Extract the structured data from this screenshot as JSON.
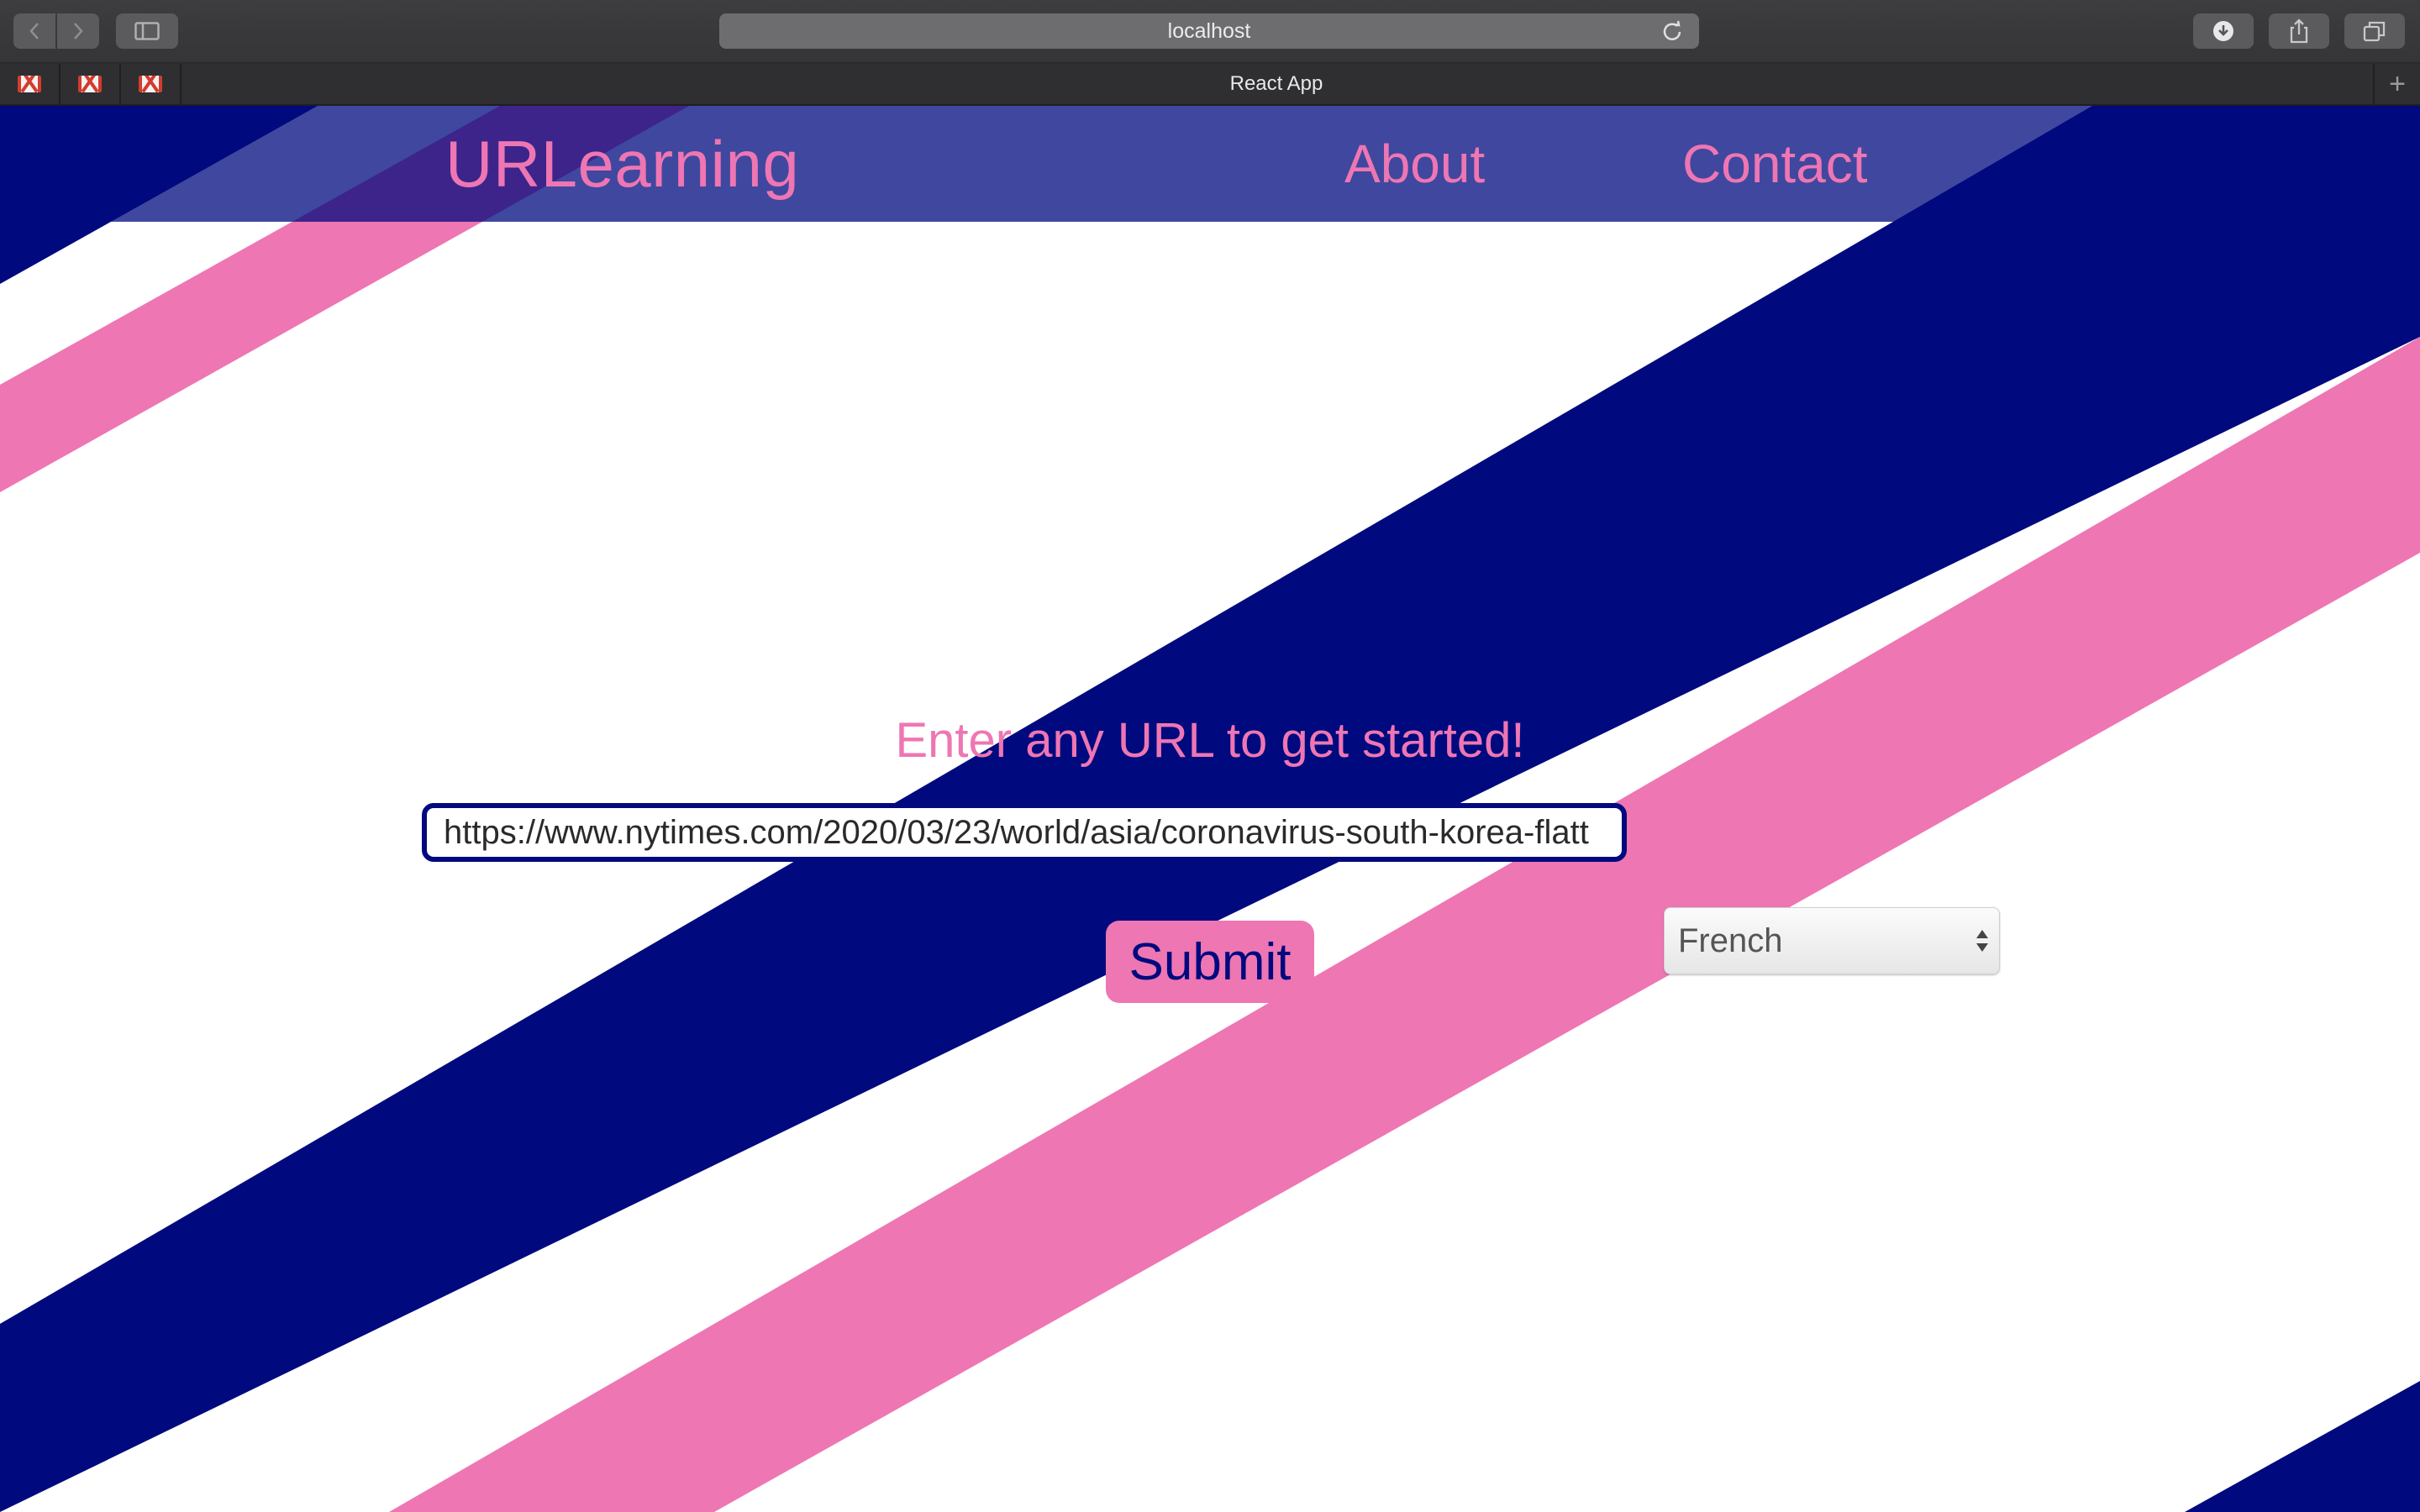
{
  "browser": {
    "address": "localhost",
    "active_tab_title": "React App",
    "pinned_tabs": [
      {
        "icon": "gmail-icon"
      },
      {
        "icon": "gmail-icon"
      },
      {
        "icon": "gmail-icon"
      }
    ],
    "icons": {
      "back": "chevron-left-icon",
      "forward": "chevron-right-icon",
      "sidebar": "sidebar-icon",
      "reload": "reload-icon",
      "downloads": "download-icon",
      "share": "share-icon",
      "tabs_overview": "tabs-overview-icon",
      "new_tab": "plus-icon"
    }
  },
  "app": {
    "brand": "URLearning",
    "nav": {
      "about": "About",
      "contact": "Contact"
    },
    "prompt": "Enter any URL to get started!",
    "url_input_value": "https://www.nytimes.com/2020/03/23/world/asia/coronavirus-south-korea-flatt",
    "language_selected": "French",
    "submit_label": "Submit"
  },
  "colors": {
    "navy": "#000a7e",
    "pink": "#ee76b3",
    "white": "#ffffff",
    "header_overlay": "rgba(0,10,126,0.75)"
  }
}
